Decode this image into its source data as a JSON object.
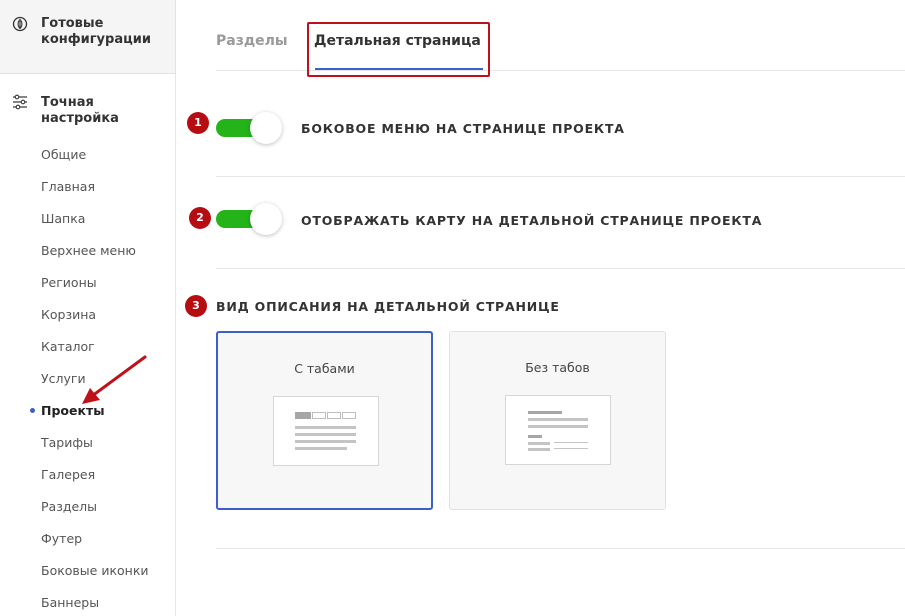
{
  "sidebar": {
    "configs_label": "Готовые конфигурации",
    "fine_tune_label": "Точная настройка",
    "items": [
      {
        "label": "Общие"
      },
      {
        "label": "Главная"
      },
      {
        "label": "Шапка"
      },
      {
        "label": "Верхнее меню"
      },
      {
        "label": "Регионы"
      },
      {
        "label": "Корзина"
      },
      {
        "label": "Каталог"
      },
      {
        "label": "Услуги"
      },
      {
        "label": "Проекты",
        "active": true
      },
      {
        "label": "Тарифы"
      },
      {
        "label": "Галерея"
      },
      {
        "label": "Разделы"
      },
      {
        "label": "Футер"
      },
      {
        "label": "Боковые иконки"
      },
      {
        "label": "Баннеры"
      }
    ]
  },
  "tabs": {
    "sections": "Разделы",
    "detail": "Детальная страница",
    "active": "detail"
  },
  "options": {
    "side_menu": {
      "badge": "1",
      "label": "БОКОВОЕ МЕНЮ НА СТРАНИЦЕ ПРОЕКТА",
      "enabled": true
    },
    "show_map": {
      "badge": "2",
      "label": "ОТОБРАЖАТЬ КАРТУ НА ДЕТАЛЬНОЙ СТРАНИЦЕ ПРОЕКТА",
      "enabled": true
    },
    "description_view": {
      "badge": "3",
      "label": "ВИД ОПИСАНИЯ НА ДЕТАЛЬНОЙ СТРАНИЦЕ",
      "cards": [
        {
          "label": "С табами",
          "selected": true
        },
        {
          "label": "Без табов",
          "selected": false
        }
      ]
    }
  },
  "colors": {
    "accent": "#3d5fc9",
    "toggle_on": "#24b419",
    "badge": "#b50d12",
    "highlight": "#c0111a"
  }
}
